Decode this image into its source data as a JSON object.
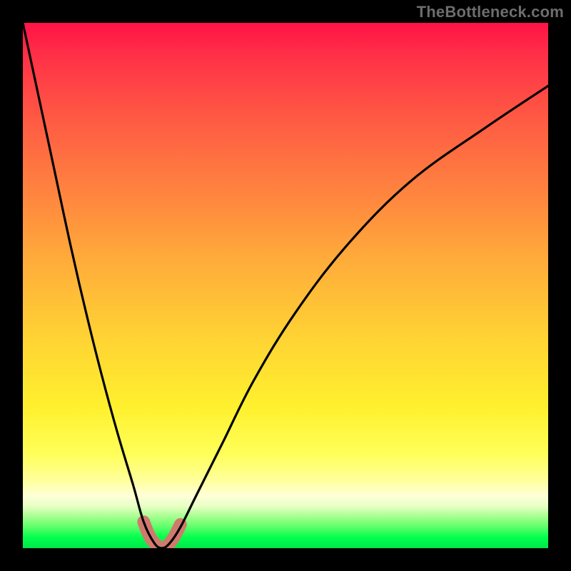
{
  "watermark": "TheBottleneck.com",
  "chart_data": {
    "type": "line",
    "title": "",
    "xlabel": "",
    "ylabel": "",
    "xlim": [
      0,
      100
    ],
    "ylim": [
      0,
      100
    ],
    "grid": false,
    "legend": false,
    "background_gradient": {
      "orientation": "vertical",
      "stops": [
        {
          "pos": 0.0,
          "color": "#ff1346"
        },
        {
          "pos": 0.18,
          "color": "#ff5944"
        },
        {
          "pos": 0.46,
          "color": "#ffae3a"
        },
        {
          "pos": 0.73,
          "color": "#fff02e"
        },
        {
          "pos": 0.9,
          "color": "#ffffd8"
        },
        {
          "pos": 1.0,
          "color": "#00e64a"
        }
      ]
    },
    "series": [
      {
        "name": "bottleneck-curve",
        "color": "#000000",
        "x": [
          0,
          3,
          6,
          9,
          12,
          15,
          18,
          21,
          23,
          25,
          26.5,
          28,
          30,
          33,
          38,
          44,
          52,
          62,
          74,
          88,
          100
        ],
        "y": [
          100,
          86,
          72,
          58,
          45,
          33,
          22,
          12,
          5,
          1,
          0,
          1,
          4,
          10,
          20,
          32,
          45,
          58,
          70,
          80,
          88
        ]
      }
    ],
    "marker": {
      "name": "trough-highlight",
      "color": "#d07a6e",
      "x": [
        23.0,
        24.0,
        25.0,
        26.0,
        27.0,
        28.0,
        29.0,
        30.0
      ],
      "y": [
        5.0,
        2.5,
        1.0,
        0.2,
        0.2,
        1.0,
        2.5,
        4.5
      ]
    }
  }
}
